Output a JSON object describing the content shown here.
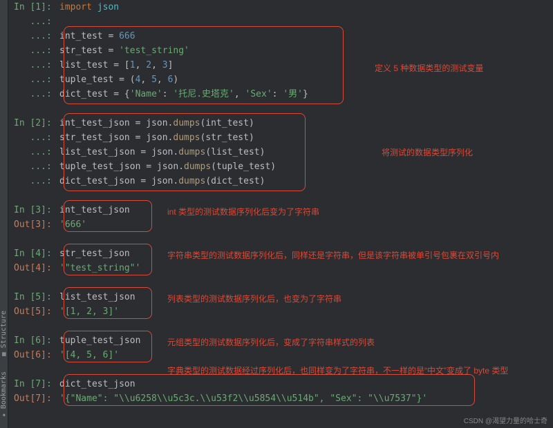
{
  "side_tabs": {
    "bookmarks": "Bookmarks",
    "structure": "Structure"
  },
  "cells": {
    "c1": {
      "prompt": "In [1]:",
      "cont": "   ...:",
      "l0": {
        "kw": "import",
        "mod": "json"
      },
      "l2": {
        "var": "int_test",
        "op": " = ",
        "val": "666"
      },
      "l3": {
        "var": "str_test",
        "op": " = ",
        "val": "'test_string'"
      },
      "l4": {
        "var": "list_test",
        "op": " = [",
        "n1": "1",
        "c1": ", ",
        "n2": "2",
        "c2": ", ",
        "n3": "3",
        "close": "]"
      },
      "l5": {
        "var": "tuple_test",
        "op": " = (",
        "n1": "4",
        "c1": ", ",
        "n2": "5",
        "c2": ", ",
        "n3": "6",
        "close": ")"
      },
      "l6": {
        "var": "dict_test",
        "op": " = {",
        "k1": "'Name'",
        "col1": ": ",
        "v1": "'托尼.史塔克'",
        "sep": ", ",
        "k2": "'Sex'",
        "col2": ": ",
        "v2": "'男'",
        "close": "}"
      }
    },
    "c2": {
      "prompt": "In [2]:",
      "cont": "   ...:",
      "l0": {
        "var": "int_test_json",
        "op": " = ",
        "obj": "json",
        "dot": ".",
        "fn": "dumps",
        "open": "(",
        "arg": "int_test",
        "close": ")"
      },
      "l1": {
        "var": "str_test_json",
        "op": " = ",
        "obj": "json",
        "dot": ".",
        "fn": "dumps",
        "open": "(",
        "arg": "str_test",
        "close": ")"
      },
      "l2": {
        "var": "list_test_json",
        "op": " = ",
        "obj": "json",
        "dot": ".",
        "fn": "dumps",
        "open": "(",
        "arg": "list_test",
        "close": ")"
      },
      "l3": {
        "var": "tuple_test_json",
        "op": " = ",
        "obj": "json",
        "dot": ".",
        "fn": "dumps",
        "open": "(",
        "arg": "tuple_test",
        "close": ")"
      },
      "l4": {
        "var": "dict_test_json",
        "op": " = ",
        "obj": "json",
        "dot": ".",
        "fn": "dumps",
        "open": "(",
        "arg": "dict_test",
        "close": ")"
      }
    },
    "c3": {
      "in": "In [3]:",
      "out": "Out[3]:",
      "expr": "int_test_json",
      "result": "'666'"
    },
    "c4": {
      "in": "In [4]:",
      "out": "Out[4]:",
      "expr": "str_test_json",
      "result": "'\"test_string\"'"
    },
    "c5": {
      "in": "In [5]:",
      "out": "Out[5]:",
      "expr": "list_test_json",
      "result": "'[1, 2, 3]'"
    },
    "c6": {
      "in": "In [6]:",
      "out": "Out[6]:",
      "expr": "tuple_test_json",
      "result": "'[4, 5, 6]'"
    },
    "c7": {
      "in": "In [7]:",
      "out": "Out[7]:",
      "expr": "dict_test_json",
      "result": "'{\"Name\": \"\\\\u6258\\\\u5c3c.\\\\u53f2\\\\u5854\\\\u514b\", \"Sex\": \"\\\\u7537\"}'"
    }
  },
  "annotations": {
    "a1": "定义 5 种数据类型的测试变量",
    "a2": "将测试的数据类型序列化",
    "a3": "int 类型的测试数据序列化后变为了字符串",
    "a4": "字符串类型的测试数据序列化后，同样还是字符串，但是该字符串被单引号包裹在双引号内",
    "a5": "列表类型的测试数据序列化后，也变为了字符串",
    "a6": "元组类型的测试数据序列化后，变成了字符串样式的列表",
    "a7": "字典类型的测试数据经过序列化后，也同样变为了字符串，不一样的是“中文”变成了 byte 类型"
  },
  "watermark": "CSDN @渴望力量的哈士奇"
}
